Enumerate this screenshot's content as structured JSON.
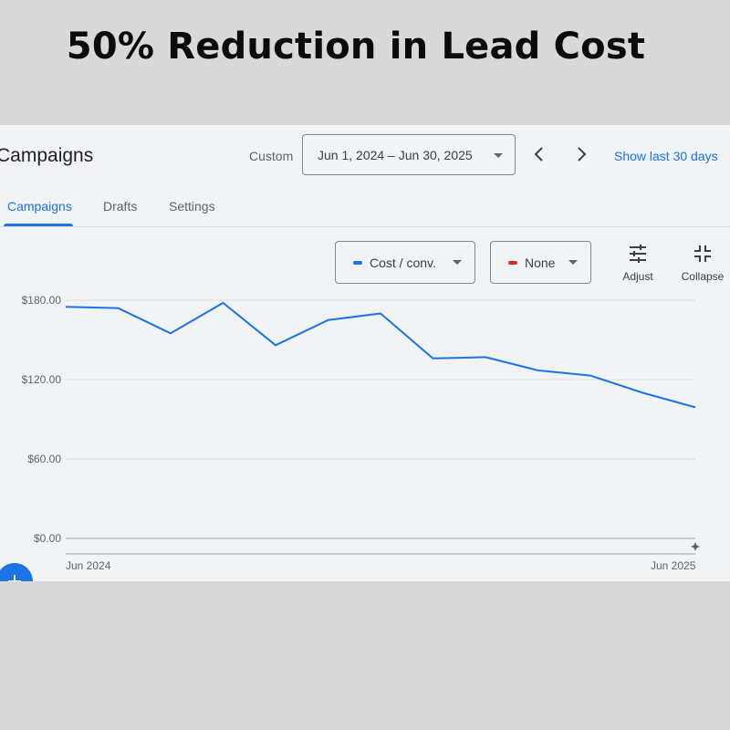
{
  "headline": "50% Reduction in Lead Cost",
  "header": {
    "page_title": "Campaigns",
    "date_label": "Custom",
    "date_range": "Jun 1, 2024 – Jun 30, 2025",
    "show_last": "Show last 30 days"
  },
  "tabs": [
    {
      "label": "Campaigns",
      "active": true
    },
    {
      "label": "Drafts",
      "active": false
    },
    {
      "label": "Settings",
      "active": false
    }
  ],
  "controls": {
    "metric1": {
      "label": "Cost / conv.",
      "color": "#1a73e8"
    },
    "metric2": {
      "label": "None",
      "color": "#d93025"
    },
    "adjust_label": "Adjust",
    "collapse_label": "Collapse"
  },
  "icons": [
    "chevron-left-icon",
    "chevron-right-icon",
    "dropdown-caret-icon",
    "tune-icon",
    "collapse-icon",
    "sparkle-icon",
    "add-icon"
  ],
  "chart_data": {
    "type": "line",
    "series": [
      {
        "values": [
          175,
          174,
          155,
          178,
          146,
          165,
          170,
          136,
          137,
          127,
          123,
          110,
          99
        ],
        "color": "#1a73e8"
      }
    ],
    "x_tick_labels": [
      "Jun 2024",
      "Jun 2025"
    ],
    "y_tick_labels": [
      "$180.00",
      "$120.00",
      "$60.00",
      "$0.00"
    ],
    "y_ticks": [
      180,
      120,
      60,
      0
    ],
    "ylim": [
      0,
      180
    ],
    "grid": true
  }
}
